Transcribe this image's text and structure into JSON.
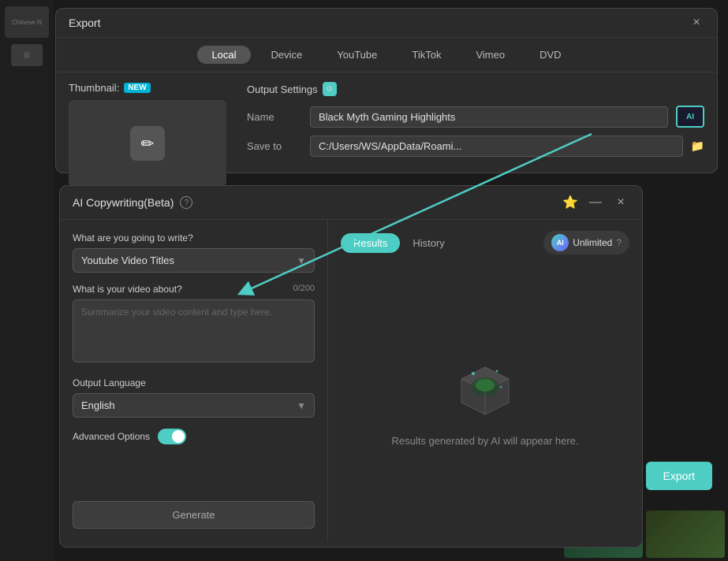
{
  "export_window": {
    "title": "Export",
    "close_label": "×",
    "tabs": [
      {
        "label": "Local",
        "active": true
      },
      {
        "label": "Device",
        "active": false
      },
      {
        "label": "YouTube",
        "active": false
      },
      {
        "label": "TikTok",
        "active": false
      },
      {
        "label": "Vimeo",
        "active": false
      },
      {
        "label": "DVD",
        "active": false
      }
    ],
    "thumbnail_label": "Thumbnail:",
    "new_badge": "NEW",
    "edit_icon": "✏",
    "output_settings_label": "Output Settings",
    "name_label": "Name",
    "name_value": "Black Myth Gaming Highlights",
    "ai_button_label": "AI",
    "save_to_label": "Save to",
    "save_to_value": "C:/Users/WS/AppData/Roami...",
    "folder_icon": "📁"
  },
  "ai_dialog": {
    "title": "AI Copywriting(Beta)",
    "help_icon": "?",
    "star_icon": "⭐",
    "minimize_icon": "—",
    "close_icon": "×",
    "what_write_label": "What are you going to write?",
    "dropdown_value": "Youtube Video Titles",
    "dropdown_arrow": "▼",
    "video_about_label": "What is your video about?",
    "char_count": "0/200",
    "textarea_placeholder": "Summarize your video content and type here.",
    "output_language_label": "Output Language",
    "language_value": "English",
    "language_arrow": "▼",
    "advanced_options_label": "Advanced Options",
    "toggle_on": true,
    "generate_button": "Generate",
    "results_tab": "Results",
    "history_tab": "History",
    "unlimited_label": "Unlimited",
    "ai_badge": "AI",
    "unlimited_help": "?",
    "results_placeholder_text": "Results generated by AI will appear here."
  },
  "export_button": "Export"
}
